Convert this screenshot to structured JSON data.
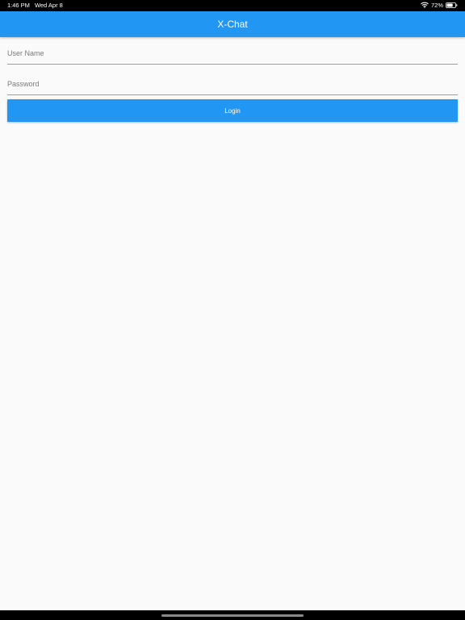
{
  "status_bar": {
    "time": "1:46 PM",
    "date": "Wed Apr 8",
    "battery_percent": "72%",
    "battery_level": 0.72,
    "icons": [
      "wifi-icon",
      "battery-icon"
    ]
  },
  "app_bar": {
    "title": "X-Chat",
    "color": "#2196f3"
  },
  "login_form": {
    "username": {
      "placeholder": "User Name",
      "value": ""
    },
    "password": {
      "placeholder": "Password",
      "value": ""
    },
    "login_label": "Login"
  },
  "colors": {
    "accent": "#2196f3",
    "background": "#fafafa",
    "button_text": "#ffffff"
  }
}
